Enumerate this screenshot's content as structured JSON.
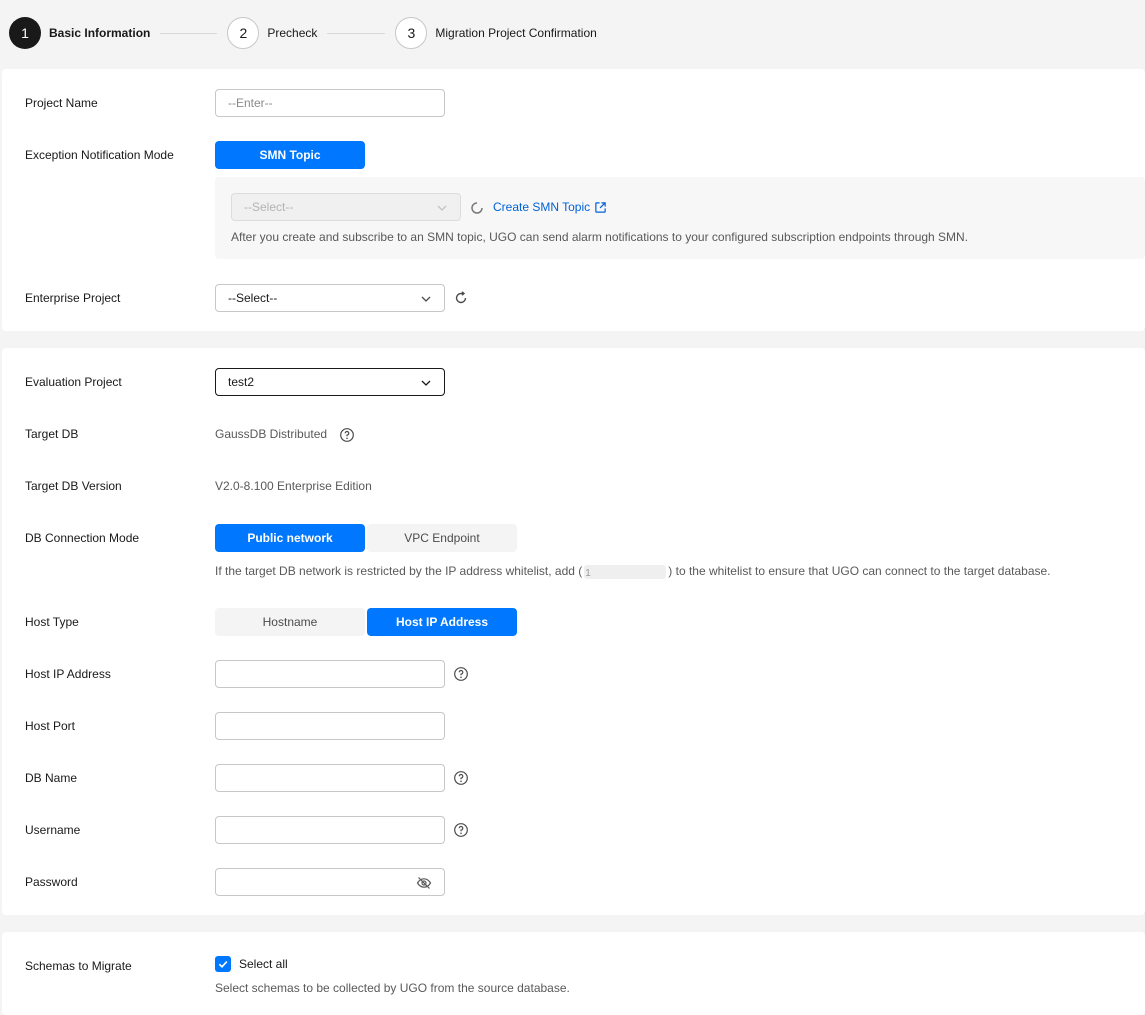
{
  "steps": [
    {
      "number": "1",
      "label": "Basic Information",
      "state": "active"
    },
    {
      "number": "2",
      "label": "Precheck",
      "state": "inactive"
    },
    {
      "number": "3",
      "label": "Migration Project Confirmation",
      "state": "inactive"
    }
  ],
  "basic": {
    "project_name_label": "Project Name",
    "project_name_placeholder": "--Enter--",
    "notification_label": "Exception Notification Mode",
    "smn_button": "SMN Topic",
    "smn_select_placeholder": "--Select--",
    "create_smn_link": "Create SMN Topic",
    "smn_hint": "After you create and subscribe to an SMN topic, UGO can send alarm notifications to your configured subscription endpoints through SMN.",
    "enterprise_label": "Enterprise Project",
    "enterprise_value": "--Select--"
  },
  "db": {
    "evaluation_label": "Evaluation Project",
    "evaluation_value": "test2",
    "target_db_label": "Target DB",
    "target_db_value": "GaussDB Distributed",
    "target_version_label": "Target DB Version",
    "target_version_value": "V2.0-8.100 Enterprise Edition",
    "connection_label": "DB Connection Mode",
    "connection_options": [
      "Public network",
      "VPC Endpoint"
    ],
    "connection_hint_before": "If the target DB network is restricted by the IP address whitelist, add (",
    "connection_hint_masked": "1",
    "connection_hint_after": ") to the whitelist to ensure that UGO can connect to the target database.",
    "host_type_label": "Host Type",
    "host_type_options": [
      "Hostname",
      "Host IP Address"
    ],
    "host_ip_label": "Host IP Address",
    "host_port_label": "Host Port",
    "db_name_label": "DB Name",
    "username_label": "Username",
    "password_label": "Password"
  },
  "schemas": {
    "label": "Schemas to Migrate",
    "select_all": "Select all",
    "hint": "Select schemas to be collected by UGO from the source database."
  },
  "colors": {
    "primary": "#0077ff",
    "link": "#0062d6",
    "text": "#191919"
  }
}
